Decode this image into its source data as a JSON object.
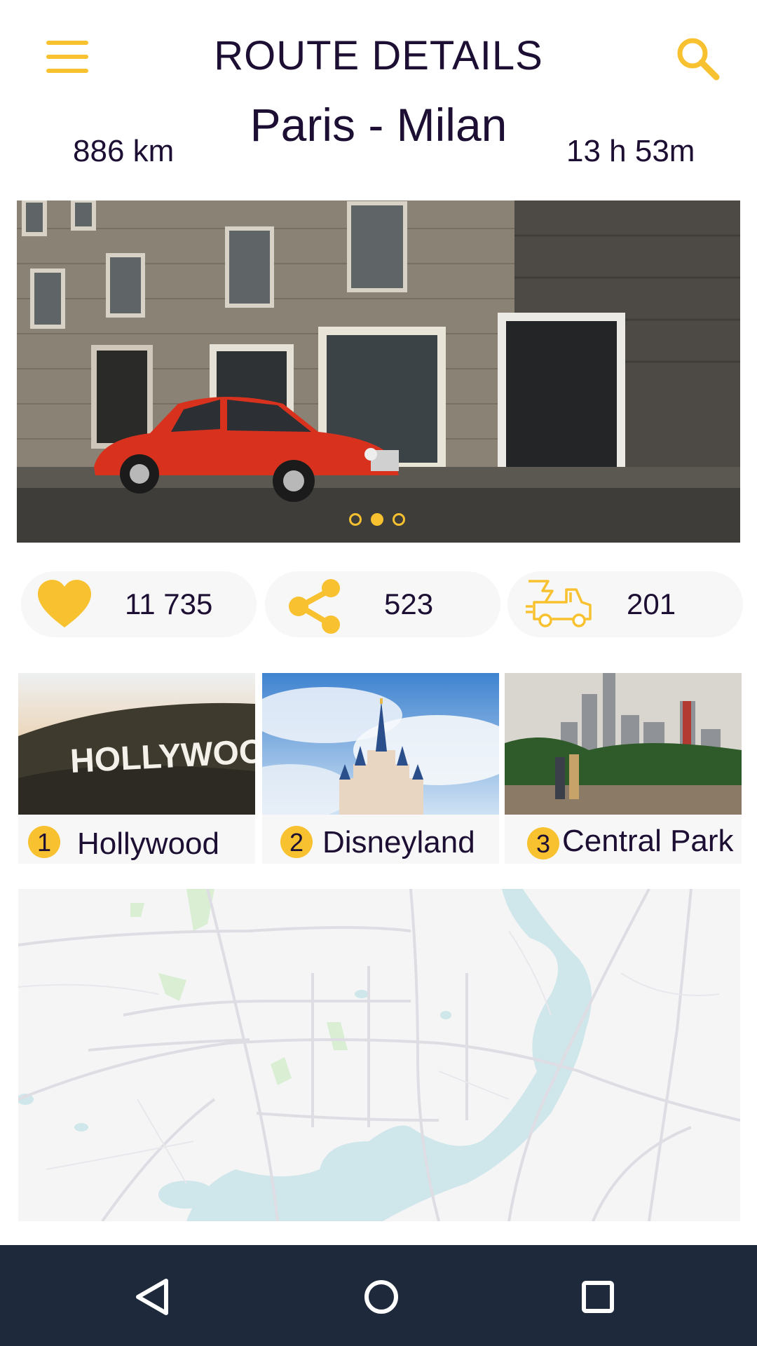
{
  "header": {
    "title": "ROUTE DETAILS",
    "menu_icon": "hamburger-menu-icon",
    "search_icon": "search-icon"
  },
  "route": {
    "name": "Paris - Milan",
    "distance": "886 km",
    "duration": "13 h 53m"
  },
  "hero": {
    "image": "street-with-red-car-photo",
    "carousel_pages": 3,
    "active_page": 2
  },
  "stats": {
    "likes": {
      "icon": "heart-icon",
      "value": "11 735"
    },
    "shares": {
      "icon": "share-icon",
      "value": "523"
    },
    "trips": {
      "icon": "truck-icon",
      "value": "201"
    }
  },
  "stops": [
    {
      "number": "1",
      "name": "Hollywood",
      "image": "hollywood-sign-photo"
    },
    {
      "number": "2",
      "name": "Disneyland",
      "image": "castle-photo"
    },
    {
      "number": "3",
      "name": "Central Park",
      "image": "city-park-photo"
    }
  ],
  "map": {
    "type": "route-map"
  },
  "navigation_bar": {
    "back_icon": "back-triangle-icon",
    "home_icon": "home-circle-icon",
    "recents_icon": "recents-square-icon"
  },
  "colors": {
    "accent": "#f8c12f",
    "text": "#1d0f33",
    "nav_bar": "#1e2a3b",
    "pill_bg": "#f7f7f7"
  }
}
